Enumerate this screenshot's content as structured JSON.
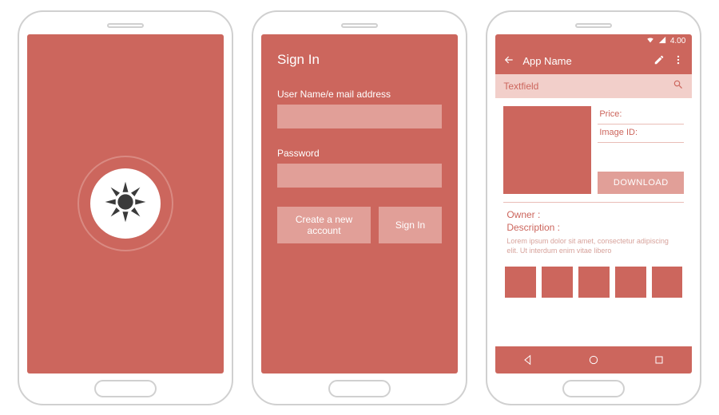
{
  "colors": {
    "primary": "#cc665d",
    "primary_light": "#e19f98",
    "primary_pale": "#f2cfca"
  },
  "splash": {
    "icon": "sun-icon"
  },
  "signin": {
    "title": "Sign In",
    "username_label": "User Name/e mail address",
    "password_label": "Password",
    "create_account_label": "Create a new account",
    "signin_label": "Sign In"
  },
  "detail": {
    "statusbar": {
      "time": "4.00"
    },
    "appbar": {
      "title": "App Name"
    },
    "search": {
      "placeholder": "Textfield"
    },
    "meta": {
      "price_label": "Price:",
      "image_id_label": "Image ID:"
    },
    "download_label": "DOWNLOAD",
    "owner_label": "Owner :",
    "description_label": "Description :",
    "description_text": "Lorem ipsum dolor sit amet, consectetur adipiscing elit. Ut interdum enim vitae libero",
    "thumbnails": [
      1,
      2,
      3,
      4,
      5
    ]
  }
}
